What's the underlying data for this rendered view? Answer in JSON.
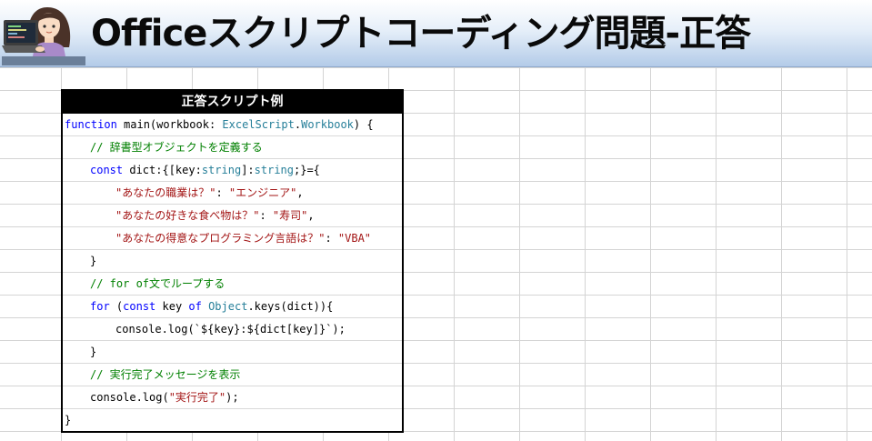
{
  "banner": {
    "title": "Officeスクリプトコーディング問題-正答"
  },
  "code_box": {
    "header": "正答スクリプト例",
    "lines": [
      {
        "indent": 0,
        "tokens": [
          {
            "t": "function",
            "c": "kw"
          },
          {
            "t": " main(workbook: ",
            "c": ""
          },
          {
            "t": "ExcelScript",
            "c": "typ"
          },
          {
            "t": ".",
            "c": ""
          },
          {
            "t": "Workbook",
            "c": "typ"
          },
          {
            "t": ") {",
            "c": ""
          }
        ]
      },
      {
        "indent": 1,
        "tokens": [
          {
            "t": "// 辞書型オブジェクトを定義する",
            "c": "cmt"
          }
        ]
      },
      {
        "indent": 1,
        "tokens": [
          {
            "t": "const",
            "c": "kw"
          },
          {
            "t": " dict:{[key:",
            "c": ""
          },
          {
            "t": "string",
            "c": "typ"
          },
          {
            "t": "]:",
            "c": ""
          },
          {
            "t": "string",
            "c": "typ"
          },
          {
            "t": ";}={",
            "c": ""
          }
        ]
      },
      {
        "indent": 2,
        "tokens": [
          {
            "t": "\"あなたの職業は？\"",
            "c": "str"
          },
          {
            "t": ": ",
            "c": ""
          },
          {
            "t": "\"エンジニア\"",
            "c": "str"
          },
          {
            "t": ",",
            "c": ""
          }
        ]
      },
      {
        "indent": 2,
        "tokens": [
          {
            "t": "\"あなたの好きな食べ物は？\"",
            "c": "str"
          },
          {
            "t": ": ",
            "c": ""
          },
          {
            "t": "\"寿司\"",
            "c": "str"
          },
          {
            "t": ",",
            "c": ""
          }
        ]
      },
      {
        "indent": 2,
        "tokens": [
          {
            "t": "\"あなたの得意なプログラミング言語は？\"",
            "c": "str"
          },
          {
            "t": ": ",
            "c": ""
          },
          {
            "t": "\"VBA\"",
            "c": "str"
          }
        ]
      },
      {
        "indent": 1,
        "tokens": [
          {
            "t": "}",
            "c": ""
          }
        ]
      },
      {
        "indent": 1,
        "tokens": [
          {
            "t": "// for of文でループする",
            "c": "cmt"
          }
        ]
      },
      {
        "indent": 1,
        "tokens": [
          {
            "t": "for",
            "c": "kw"
          },
          {
            "t": " (",
            "c": ""
          },
          {
            "t": "const",
            "c": "kw"
          },
          {
            "t": " key ",
            "c": ""
          },
          {
            "t": "of",
            "c": "kw"
          },
          {
            "t": " ",
            "c": ""
          },
          {
            "t": "Object",
            "c": "typ"
          },
          {
            "t": ".keys(dict)){",
            "c": ""
          }
        ]
      },
      {
        "indent": 2,
        "tokens": [
          {
            "t": "console.log(`${key}:${dict[key]}`);",
            "c": ""
          }
        ]
      },
      {
        "indent": 1,
        "tokens": [
          {
            "t": "}",
            "c": ""
          }
        ]
      },
      {
        "indent": 1,
        "tokens": [
          {
            "t": "// 実行完了メッセージを表示",
            "c": "cmt"
          }
        ]
      },
      {
        "indent": 1,
        "tokens": [
          {
            "t": "console.log(",
            "c": ""
          },
          {
            "t": "\"実行完了\"",
            "c": "str"
          },
          {
            "t": ");",
            "c": ""
          }
        ]
      },
      {
        "indent": 0,
        "tokens": [
          {
            "t": "}",
            "c": ""
          }
        ]
      }
    ]
  },
  "colors": {
    "keyword": "#0000ff",
    "type": "#267f99",
    "comment": "#008000",
    "string": "#a31515",
    "header_bg": "#000000",
    "banner_gradient_bottom": "#b3cbe8"
  },
  "icons": {
    "avatar": "woman-at-laptop-illustration-icon"
  }
}
